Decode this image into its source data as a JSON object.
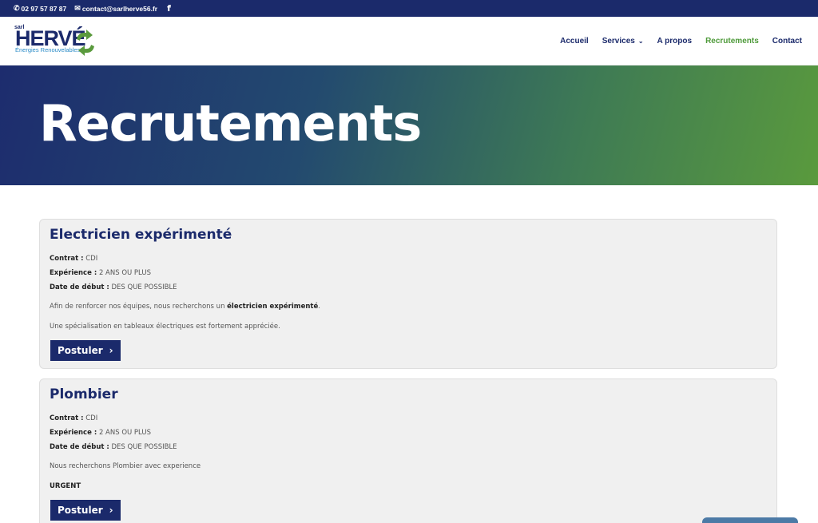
{
  "topbar": {
    "phone": "02 97 57 87 87",
    "email": "contact@sarlherve56.fr",
    "phone_icon": "phone-icon",
    "email_icon": "envelope-icon",
    "social_icon": "facebook-icon"
  },
  "logo": {
    "prefix": "sarl",
    "name": "HERVÉ",
    "tagline": "Énergies Renouvelables"
  },
  "nav": {
    "items": [
      {
        "label": "Accueil"
      },
      {
        "label": "Services"
      },
      {
        "label": "A propos"
      },
      {
        "label": "Recrutements"
      },
      {
        "label": "Contact"
      }
    ],
    "active_color": "#4e9a3a",
    "text_color": "#1b2a6b"
  },
  "hero": {
    "title": "Recrutements"
  },
  "jobs": [
    {
      "title": "Electricien expérimenté",
      "contrat_label": "Contrat :",
      "contrat": "CDI",
      "experience_label": "Expérience :",
      "experience": "2 ANS OU PLUS",
      "date_label": "Date de début :",
      "date": "DES QUE POSSIBLE",
      "desc_before": "Afin de renforcer nos équipes, nous recherchons un ",
      "desc_bold": "électricien expérimenté",
      "desc_after": ".",
      "desc2": "Une spécialisation en tableaux électriques est fortement appréciée.",
      "button": "Postuler"
    },
    {
      "title": "Plombier",
      "contrat_label": "Contrat :",
      "contrat": "CDI",
      "experience_label": "Expérience :",
      "experience": "2 ANS OU PLUS",
      "date_label": "Date de début :",
      "date": "DES QUE POSSIBLE",
      "desc": "Nous recherchons Plombier avec experience",
      "urgent": "URGENT",
      "button": "Postuler"
    }
  ],
  "colors": {
    "brand_navy": "#1b2a6b",
    "brand_green": "#5a9a3d"
  }
}
